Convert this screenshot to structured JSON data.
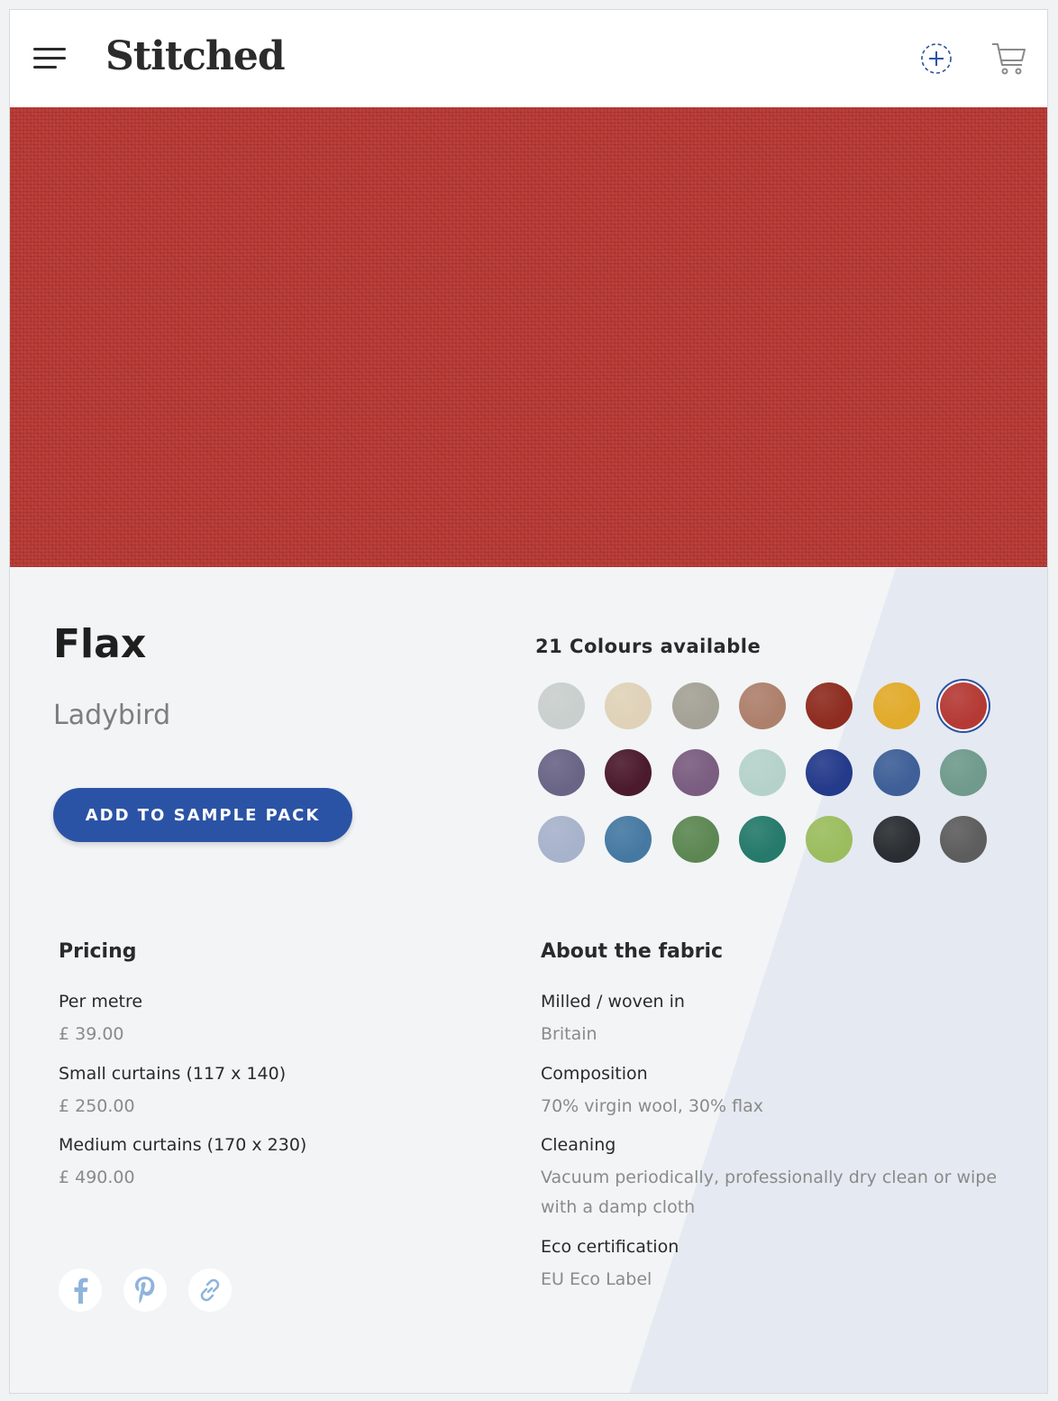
{
  "header": {
    "logo": "Stitched",
    "menu_icon": "hamburger-menu-icon",
    "add_icon": "add-circle-icon",
    "cart_icon": "shopping-cart-icon"
  },
  "product": {
    "name": "Flax",
    "colour_name": "Ladybird",
    "cta_label": "ADD TO SAMPLE PACK"
  },
  "colours": {
    "heading": "21 Colours available",
    "selected_index": 6,
    "swatches": [
      "#c9cfcd",
      "#dfd2b8",
      "#a4a196",
      "#ad806c",
      "#8e2c20",
      "#e1ab2b",
      "#b53a35",
      "#6a6486",
      "#4b1a2d",
      "#7a5d80",
      "#b5d2ca",
      "#243a8a",
      "#3e5f97",
      "#6f9a8c",
      "#a7b3cb",
      "#4679a2",
      "#5c8752",
      "#257a6b",
      "#9bbd5e",
      "#2a2d31",
      "#5d5d5e"
    ]
  },
  "pricing": {
    "heading": "Pricing",
    "items": [
      {
        "label": "Per metre",
        "value": "£ 39.00"
      },
      {
        "label": "Small curtains (117 x 140)",
        "value": "£ 250.00"
      },
      {
        "label": "Medium curtains (170 x 230)",
        "value": "£ 490.00"
      }
    ]
  },
  "about": {
    "heading": "About the fabric",
    "items": [
      {
        "label": "Milled / woven in",
        "value": "Britain"
      },
      {
        "label": "Composition",
        "value": "70% virgin wool, 30% flax"
      },
      {
        "label": "Cleaning",
        "value": "Vacuum periodically, professionally dry clean or wipe with a damp cloth"
      },
      {
        "label": "Eco certification",
        "value": "EU Eco Label"
      }
    ]
  },
  "social": {
    "icons": [
      "facebook-icon",
      "pinterest-icon",
      "link-icon"
    ],
    "icon_color": "#8fb4dc"
  },
  "colors": {
    "accent": "#2b53a5",
    "hero_fabric": "#b53a35"
  }
}
